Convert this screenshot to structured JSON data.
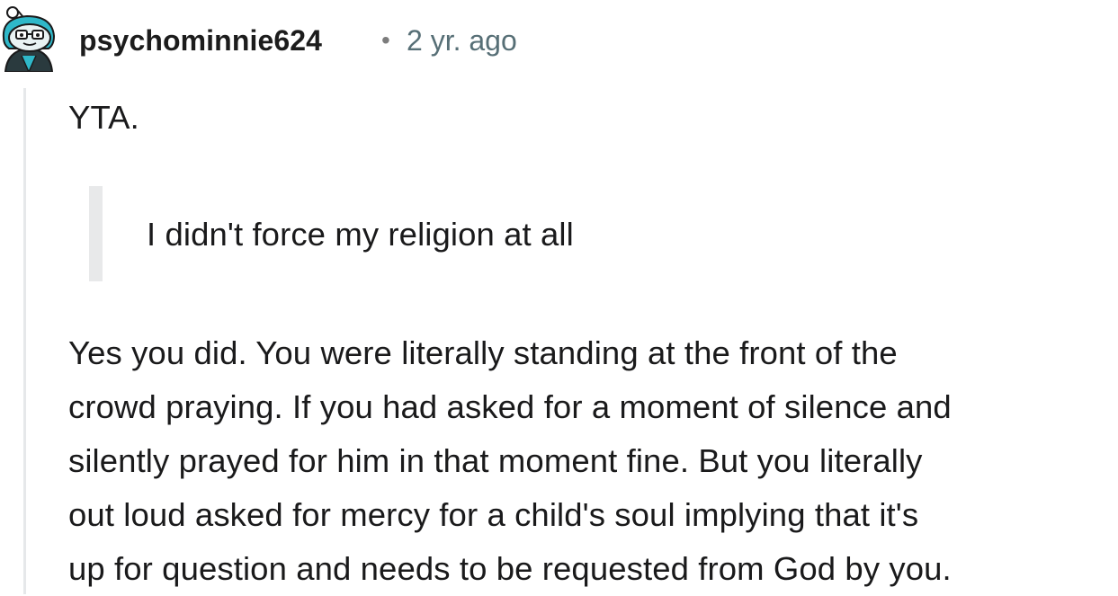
{
  "comment": {
    "username": "psychominnie624",
    "separator": "•",
    "timestamp": "2 yr. ago",
    "verdict": "YTA.",
    "quote": "I didn't force my religion at all",
    "paragraph_lines": [
      "Yes you did. You were literally standing at the front of the",
      "crowd praying. If you had asked for a moment of silence and",
      "silently prayed for him in that moment fine. But you literally",
      "out loud asked for mercy for a child's soul implying that it's",
      "up for question and needs to be requested from God by you."
    ],
    "avatar_icon": "snoo-avatar-icon"
  },
  "colors": {
    "username": "#1c1c1c",
    "timestamp": "#576f76",
    "thread_line": "#e6e8ea",
    "quote_bar": "#e8e9ea",
    "avatar_accent": "#2fb8c9"
  }
}
